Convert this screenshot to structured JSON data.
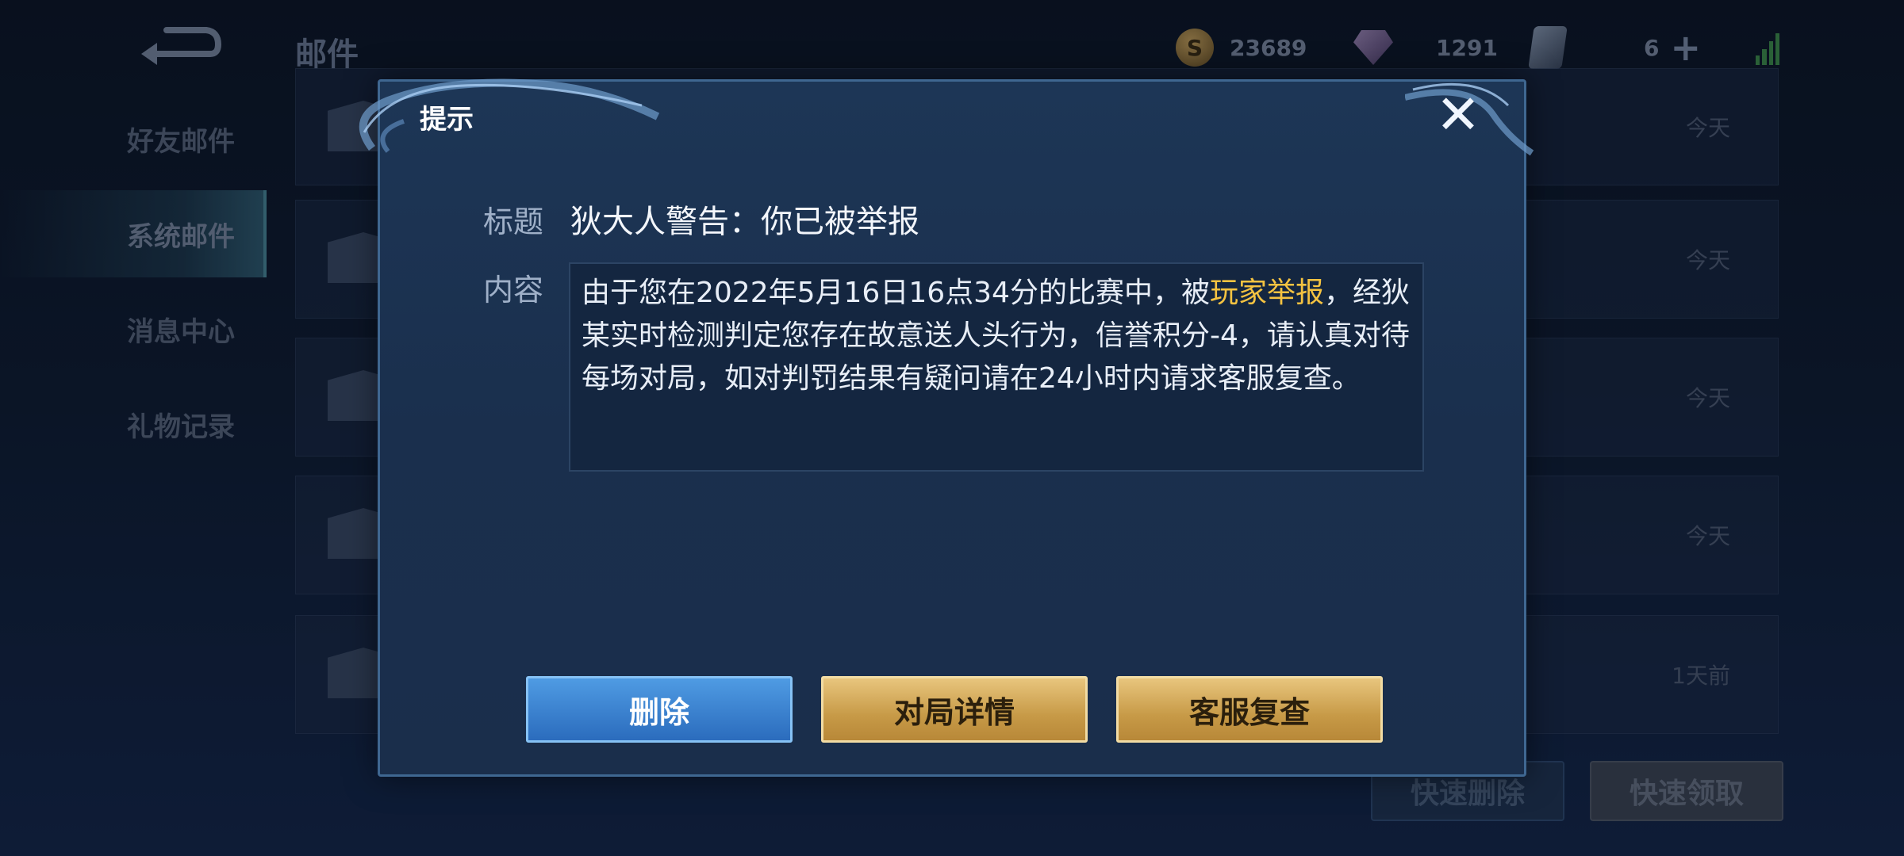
{
  "header": {
    "title": "邮件",
    "gold": "23689",
    "gems": "1291",
    "cards": "6",
    "coin_symbol": "S"
  },
  "sidebar": {
    "items": [
      {
        "label": "好友邮件"
      },
      {
        "label": "系统邮件"
      },
      {
        "label": "消息中心"
      },
      {
        "label": "礼物记录"
      }
    ]
  },
  "mail_list": {
    "dates": [
      "今天",
      "今天",
      "今天",
      "今天",
      "1天前"
    ]
  },
  "bottom": {
    "quick_delete": "快速删除",
    "quick_claim": "快速领取"
  },
  "dialog": {
    "title": "提示",
    "subject_label": "标题",
    "subject": "狄大人警告：你已被举报",
    "content_label": "内容",
    "content_before": "由于您在2022年5月16日16点34分的比赛中，被",
    "content_highlight": "玩家举报",
    "content_after": "，经狄某实时检测判定您存在故意送人头行为，信誉积分-4，请认真对待每场对局，如对判罚结果有疑问请在24小时内请求客服复查。",
    "buttons": {
      "delete": "删除",
      "match_detail": "对局详情",
      "appeal": "客服复查"
    }
  },
  "colors": {
    "highlight": "#f5c341",
    "primary_button": "#3a82d0",
    "gold_button": "#d4aa5c"
  }
}
